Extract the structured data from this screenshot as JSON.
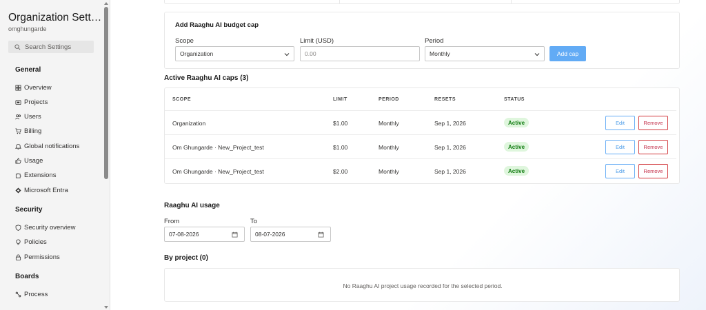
{
  "sidebar": {
    "title": "Organization Settin...",
    "subtitle": "omghungarde",
    "search_placeholder": "Search Settings",
    "sections": [
      {
        "heading": "General",
        "items": [
          {
            "label": "Overview",
            "icon": "grid-icon"
          },
          {
            "label": "Projects",
            "icon": "projects-icon"
          },
          {
            "label": "Users",
            "icon": "users-icon"
          },
          {
            "label": "Billing",
            "icon": "cart-icon"
          },
          {
            "label": "Global notifications",
            "icon": "bell-icon"
          },
          {
            "label": "Usage",
            "icon": "thumb-icon"
          },
          {
            "label": "Extensions",
            "icon": "puzzle-icon"
          },
          {
            "label": "Microsoft Entra",
            "icon": "entra-icon"
          }
        ]
      },
      {
        "heading": "Security",
        "items": [
          {
            "label": "Security overview",
            "icon": "shield-icon"
          },
          {
            "label": "Policies",
            "icon": "lightbulb-icon"
          },
          {
            "label": "Permissions",
            "icon": "lock-icon"
          }
        ]
      },
      {
        "heading": "Boards",
        "items": [
          {
            "label": "Process",
            "icon": "process-icon"
          }
        ]
      }
    ]
  },
  "budget_cap": {
    "title": "Add Raaghu AI budget cap",
    "scope_label": "Scope",
    "scope_value": "Organization",
    "limit_label": "Limit (USD)",
    "limit_placeholder": "0.00",
    "period_label": "Period",
    "period_value": "Monthly",
    "add_button": "Add cap"
  },
  "caps": {
    "title": "Active Raaghu AI caps (3)",
    "columns": [
      "SCOPE",
      "LIMIT",
      "PERIOD",
      "RESETS",
      "STATUS"
    ],
    "rows": [
      {
        "scope": "Organization",
        "limit": "$1.00",
        "period": "Monthly",
        "resets": "Sep 1, 2026",
        "status": "Active",
        "edit": "Edit",
        "remove": "Remove"
      },
      {
        "scope": "Om Ghungarde · New_Project_test",
        "limit": "$1.00",
        "period": "Monthly",
        "resets": "Sep 1, 2026",
        "status": "Active",
        "edit": "Edit",
        "remove": "Remove"
      },
      {
        "scope": "Om Ghungarde · New_Project_test",
        "limit": "$2.00",
        "period": "Monthly",
        "resets": "Sep 1, 2026",
        "status": "Active",
        "edit": "Edit",
        "remove": "Remove"
      }
    ]
  },
  "usage": {
    "title": "Raaghu AI usage",
    "from_label": "From",
    "from_value": "07-08-2026",
    "to_label": "To",
    "to_value": "08-07-2026",
    "by_project_title": "By project (0)",
    "empty_message": "No Raaghu AI project usage recorded for the selected period."
  },
  "colors": {
    "accent": "#62abf5",
    "danger": "#d13438",
    "success_bg": "#dff6dd",
    "success_text": "#107c10"
  }
}
